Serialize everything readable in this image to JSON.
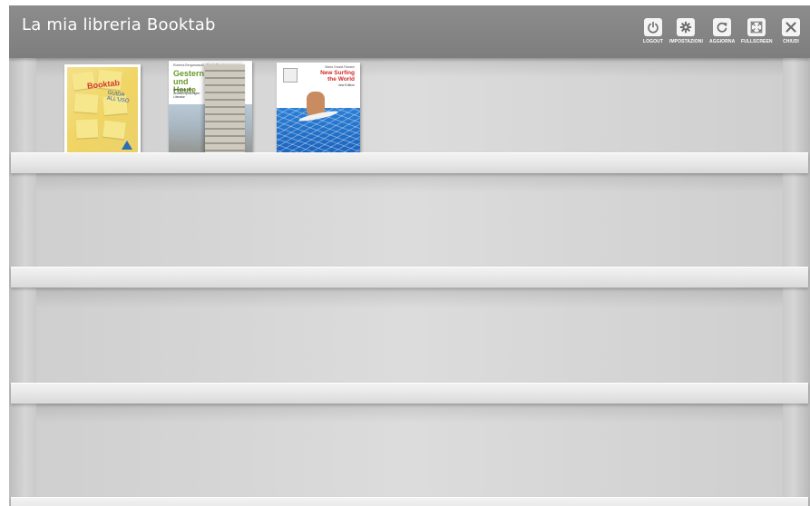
{
  "window": {
    "title": "La mia libreria Booktab"
  },
  "toolbar": {
    "items": [
      {
        "label": "LOGOUT",
        "icon": "power-icon"
      },
      {
        "label": "IMPOSTAZIONI",
        "icon": "gear-icon"
      },
      {
        "label": "AGGIORNA",
        "icon": "refresh-icon"
      },
      {
        "label": "FULLSCREEN",
        "icon": "fullscreen-icon"
      },
      {
        "label": "CHIUDI",
        "icon": "close-icon"
      }
    ]
  },
  "books": [
    {
      "cover_text": {
        "title": "Booktab",
        "subtitle": "GUIDA ALL'USO"
      }
    },
    {
      "cover_text": {
        "author": "Roberta Bergamaschi · Paola Rossi",
        "title_line1": "Gestern",
        "title_line2": "und",
        "title_line3": "Heute",
        "description": "Antologia der deutschsprachigen Literatur"
      }
    },
    {
      "cover_text": {
        "author": "Maria Grazia Ranzini",
        "title_line1": "New Surfing",
        "title_line2": "the World",
        "subtitle": "new Edition"
      }
    }
  ],
  "colors": {
    "titlebar": "#828282",
    "shelf": "#ececec",
    "accent_red": "#d4261e"
  }
}
